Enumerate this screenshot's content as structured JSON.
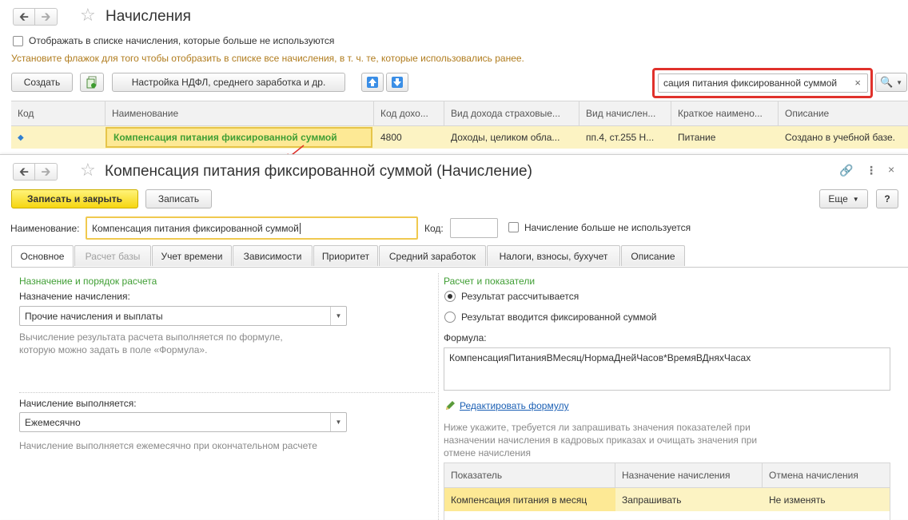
{
  "list_window": {
    "title": "Начисления",
    "show_unused_label": "Отображать в списке начисления, которые больше не используются",
    "show_unused_hint": "Установите флажок для того чтобы отобразить в списке все начисления, в т. ч. те, которые использовались ранее.",
    "toolbar": {
      "create_label": "Создать",
      "settings_label": "Настройка НДФЛ, среднего заработка и др."
    },
    "search_value": "сация питания фиксированной суммой",
    "columns": [
      "Код",
      "Наименование",
      "Код дохо...",
      "Вид дохода страховые...",
      "Вид начислен...",
      "Краткое наимено...",
      "Описание"
    ],
    "rows": [
      {
        "code": "",
        "name": "Компенсация питания фиксированной суммой",
        "income_code": "4800",
        "insurance_type": "Доходы, целиком обла...",
        "accrual_type": "пп.4, ст.255 Н...",
        "short_name": "Питание",
        "description": "Создано в учебной базе."
      }
    ]
  },
  "form_window": {
    "title": "Компенсация питания фиксированной суммой (Начисление)",
    "toolbar": {
      "save_close_label": "Записать и закрыть",
      "save_label": "Записать",
      "more_label": "Еще",
      "help_label": "?"
    },
    "name_label": "Наименование:",
    "name_value": "Компенсация питания фиксированной суммой",
    "code_label": "Код:",
    "code_value": "",
    "unused_label": "Начисление больше не используется",
    "tabs": [
      {
        "label": "Основное",
        "state": "active"
      },
      {
        "label": "Расчет базы",
        "state": "disabled"
      },
      {
        "label": "Учет времени",
        "state": "normal"
      },
      {
        "label": "Зависимости",
        "state": "normal"
      },
      {
        "label": "Приоритет",
        "state": "normal"
      },
      {
        "label": "Средний заработок",
        "state": "normal"
      },
      {
        "label": "Налоги, взносы, бухучет",
        "state": "normal"
      },
      {
        "label": "Описание",
        "state": "normal"
      }
    ],
    "left": {
      "section_title": "Назначение и порядок расчета",
      "purpose_label": "Назначение начисления:",
      "purpose_value": "Прочие начисления и выплаты",
      "purpose_hint": "Вычисление результата расчета выполняется по формуле, которую можно задать в поле «Формула».",
      "periodicity_label": "Начисление выполняется:",
      "periodicity_value": "Ежемесячно",
      "periodicity_hint": "Начисление выполняется ежемесячно при окончательном расчете"
    },
    "right": {
      "section_title": "Расчет и показатели",
      "radio_calculated": "Результат рассчитывается",
      "radio_fixed": "Результат вводится фиксированной суммой",
      "formula_label": "Формула:",
      "formula_value": "КомпенсацияПитанияВМесяц/НормаДнейЧасов*ВремяВДняхЧасах",
      "edit_formula_link": "Редактировать формулу",
      "indicators_hint": "Ниже укажите, требуется ли запрашивать значения показателей при назначении начисления в кадровых приказах и очищать значения при отмене начисления",
      "grid_columns": [
        "Показатель",
        "Назначение начисления",
        "Отмена начисления"
      ],
      "grid_rows": [
        {
          "indicator": "Компенсация питания в месяц",
          "assign": "Запрашивать",
          "cancel": "Не изменять"
        }
      ]
    }
  },
  "colors": {
    "accent_green": "#3f9e33",
    "highlight_row": "#fcf3c3",
    "primary_button": "#f6d611",
    "callout_red": "#e0312b",
    "link_blue": "#1a5fb4"
  }
}
